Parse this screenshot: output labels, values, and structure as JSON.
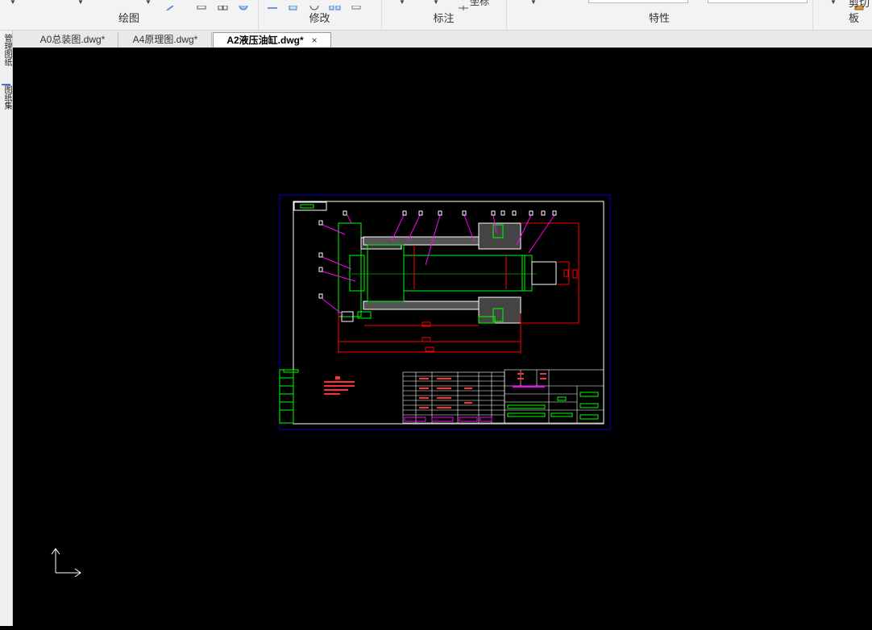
{
  "ribbon": {
    "groups": [
      {
        "name": "draw",
        "label": "绘图"
      },
      {
        "name": "modify",
        "label": "修改"
      },
      {
        "name": "annotate",
        "label": "标注"
      },
      {
        "name": "properties",
        "label": "特性"
      },
      {
        "name": "clipboard",
        "label": "剪切板"
      }
    ],
    "annotate_partial_label": "坐标"
  },
  "tabs": [
    {
      "label": "A0总装图.dwg*"
    },
    {
      "label": "A4原理图.dwg*"
    },
    {
      "label": "A2液压油缸.dwg*",
      "active": true
    }
  ],
  "tab_close_glyph": "×",
  "left_panel": {
    "items": [
      "管理图纸",
      "图纸集"
    ]
  },
  "drawing": {
    "title_block_text": "",
    "background": "#000000"
  },
  "colors": {
    "accent_blue": "#0000cc",
    "geometry_green": "#00ff00",
    "dimension_red": "#ff0000",
    "leader_magenta": "#ff00ff"
  }
}
